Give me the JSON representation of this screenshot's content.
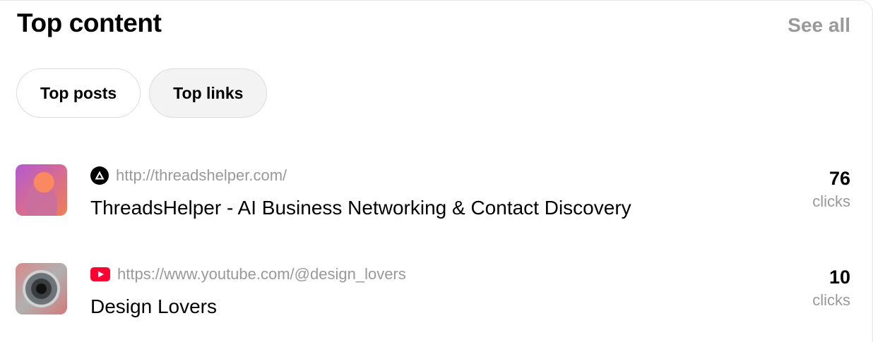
{
  "header": {
    "title": "Top content",
    "see_all": "See all"
  },
  "tabs": [
    {
      "label": "Top posts",
      "active": false
    },
    {
      "label": "Top links",
      "active": true
    }
  ],
  "items": [
    {
      "source_icon": "threads-triangle-icon",
      "url": "http://threadshelper.com/",
      "title": "ThreadsHelper - AI Business Networking & Contact Discovery",
      "count": "76",
      "unit": "clicks"
    },
    {
      "source_icon": "youtube-icon",
      "url": "https://www.youtube.com/@design_lovers",
      "title": "Design Lovers",
      "count": "10",
      "unit": "clicks"
    }
  ],
  "colors": {
    "muted_text": "#999999",
    "youtube_red": "#ff0033",
    "active_tab_bg": "#f3f3f3"
  }
}
